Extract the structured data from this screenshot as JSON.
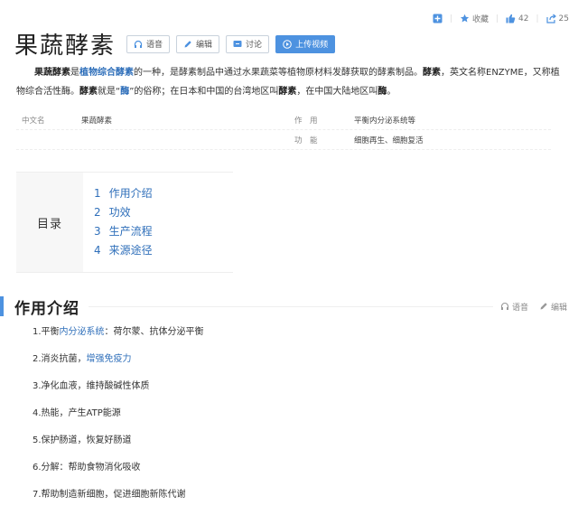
{
  "topbar": {
    "favorite_label": "收藏",
    "like_count": "42",
    "share_count": "25"
  },
  "header": {
    "title": "果蔬酵素",
    "buttons": {
      "voice": "语音",
      "edit": "编辑",
      "discuss": "讨论",
      "upload": "上传视频"
    }
  },
  "summary": {
    "p1": "果蔬酵素",
    "p2": "是",
    "p3": "植物综合酵素",
    "p4": "的一种，是酵素制品中通过水果蔬菜等植物原材料发酵获取的酵素制品。",
    "p5": "酵素",
    "p6": "，英文名称ENZYME，又称植物综合活性酶。",
    "p7": "酵素",
    "p8": "就是“",
    "p9": "酶",
    "p10": "”的俗称；在日本和中国的台湾地区叫",
    "p11": "酵素",
    "p12": "，在中国大陆地区叫",
    "p13": "酶",
    "p14": "。"
  },
  "info": {
    "row1": {
      "k1": "中文名",
      "v1": "果蔬酵素",
      "k2": "作　用",
      "v2": "平衡内分泌系统等"
    },
    "row2": {
      "k1": "",
      "v1": "",
      "k2": "功　能",
      "v2": "细胞再生、细胞复活"
    }
  },
  "toc": {
    "label": "目录",
    "items": [
      {
        "num": "1",
        "text": "作用介绍"
      },
      {
        "num": "2",
        "text": "功效"
      },
      {
        "num": "3",
        "text": "生产流程"
      },
      {
        "num": "4",
        "text": "来源途径"
      }
    ]
  },
  "section": {
    "title": "作用介绍",
    "voice": "语音",
    "edit": "编辑"
  },
  "list": {
    "i1a": "1.平衡",
    "i1b": "内分泌系统",
    "i1c": "：荷尔蒙、抗体分泌平衡",
    "i2a": "2.消炎抗菌，",
    "i2b": "增强免疫力",
    "i3": "3.净化血液，维持酸碱性体质",
    "i4": "4.热能，产生ATP能源",
    "i5": "5.保护肠道，恢复好肠道",
    "i6": "6.分解：帮助食物消化吸收",
    "i7": "7.帮助制造新细胞，促进细胞新陈代谢"
  },
  "colors": {
    "accent": "#4d92e0",
    "link": "#2f6fba"
  },
  "icons": [
    "add-icon",
    "star-icon",
    "thumbs-up-icon",
    "share-icon",
    "headphones-icon",
    "pencil-icon",
    "comment-icon",
    "play-circle-icon"
  ]
}
